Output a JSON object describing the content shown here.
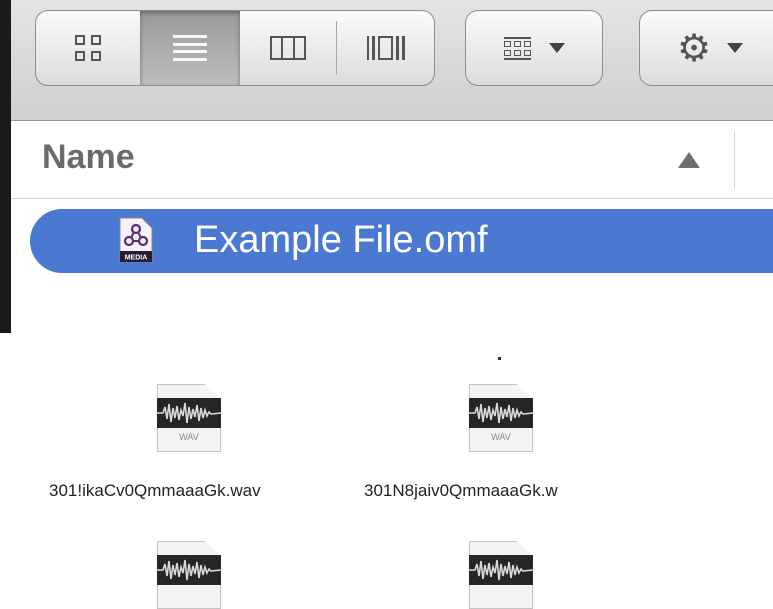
{
  "toolbar": {
    "view_modes": [
      "icon-view",
      "list-view",
      "column-view",
      "cover-flow-view"
    ],
    "selected_view": "list-view",
    "arrange_icon": "arrange-grid-icon",
    "action_icon": "gear-icon"
  },
  "list": {
    "column_header": "Name",
    "sort": "ascending",
    "selected_file": {
      "name": "Example File.omf",
      "icon": "omf-media-icon",
      "icon_label": "MEDIA",
      "highlight_color": "#4b79d1"
    }
  },
  "files": [
    {
      "name": "301!ikaCv0QmmaaaGk.wav",
      "type_label": "WAV"
    },
    {
      "name": "301N8jaiv0QmmaaaGk.w",
      "type_label": "WAV"
    },
    {
      "name": "",
      "type_label": "WAV"
    },
    {
      "name": "",
      "type_label": "WAV"
    }
  ]
}
